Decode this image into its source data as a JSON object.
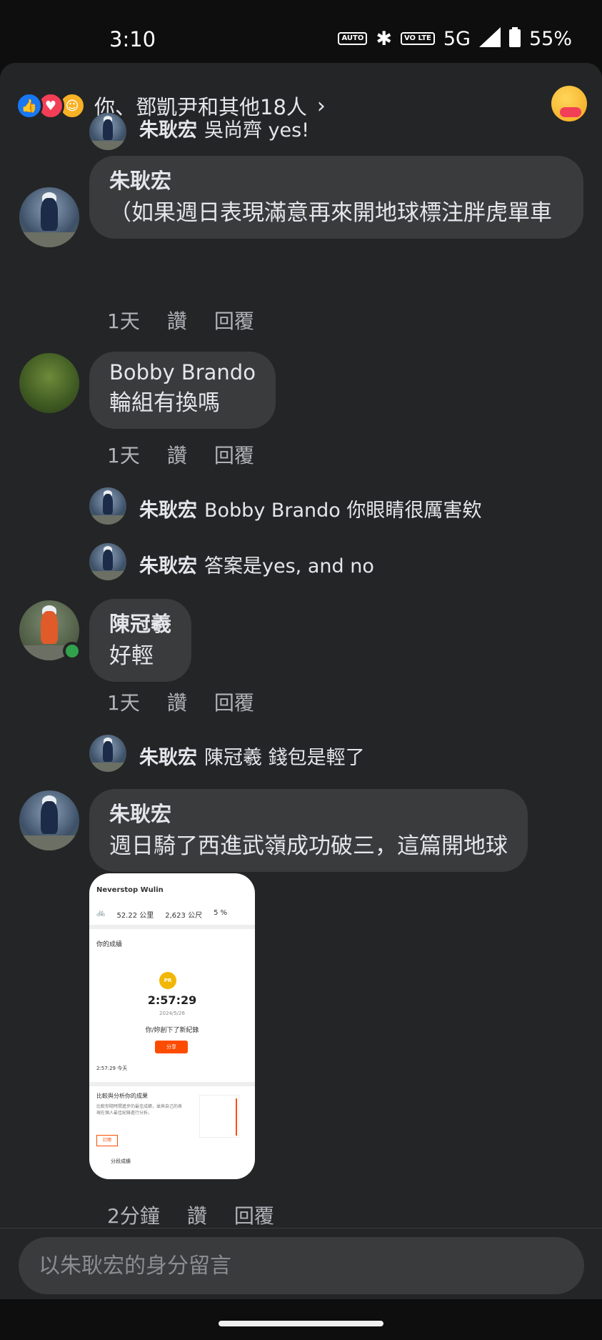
{
  "status_bar": {
    "time": "3:10",
    "network": "5G",
    "battery": "55%",
    "auto_badge": "AUTO",
    "volte_badge": "VO LTE"
  },
  "reactions": {
    "summary": "你、鄧凱尹和其他18人",
    "chevron": "›"
  },
  "comments": [
    {
      "type": "reply",
      "author": "朱耿宏",
      "text": "吳尚齊 yes!"
    },
    {
      "type": "comment",
      "author": "朱耿宏",
      "text": "（如果週日表現滿意再來開地球標注胖虎單車",
      "time": "1天",
      "like": "讚",
      "reply": "回覆"
    },
    {
      "type": "comment",
      "author": "Bobby Brando",
      "text": "輪組有換嗎",
      "time": "1天",
      "like": "讚",
      "reply": "回覆"
    },
    {
      "type": "reply",
      "author": "朱耿宏",
      "text": "Bobby Brando 你眼睛很厲害欸"
    },
    {
      "type": "reply",
      "author": "朱耿宏",
      "text": "答案是yes, and no"
    },
    {
      "type": "comment",
      "author": "陳冠羲",
      "text": "好輕",
      "time": "1天",
      "like": "讚",
      "reply": "回覆"
    },
    {
      "type": "reply",
      "author": "朱耿宏",
      "text": "陳冠羲 錢包是輕了"
    },
    {
      "type": "comment",
      "author": "朱耿宏",
      "text": "週日騎了西進武嶺成功破三，這篇開地球",
      "time": "2分鐘",
      "like": "讚",
      "reply": "回覆"
    }
  ],
  "strava_shot": {
    "segment_title": "Neverstop Wulin",
    "distance": "52.22 公里",
    "elevation": "2,623 公尺",
    "grade": "5 %",
    "section_title": "你的成績",
    "pr_badge": "PR",
    "time": "2:57:29",
    "date": "2024/5/26",
    "record_text": "你/妳創下了新紀錄",
    "share_button": "分享",
    "row_text": "2:57:29 今天",
    "compare_title": "比較與分析你的成果",
    "compare_text": "比較你隨時間進步的最佳成績，並與自己的表現在個人最佳紀錄進行分析。",
    "compare_button": "訂閱",
    "segment_result": "分段成績"
  },
  "composer": {
    "placeholder": "以朱耿宏的身分留言"
  }
}
